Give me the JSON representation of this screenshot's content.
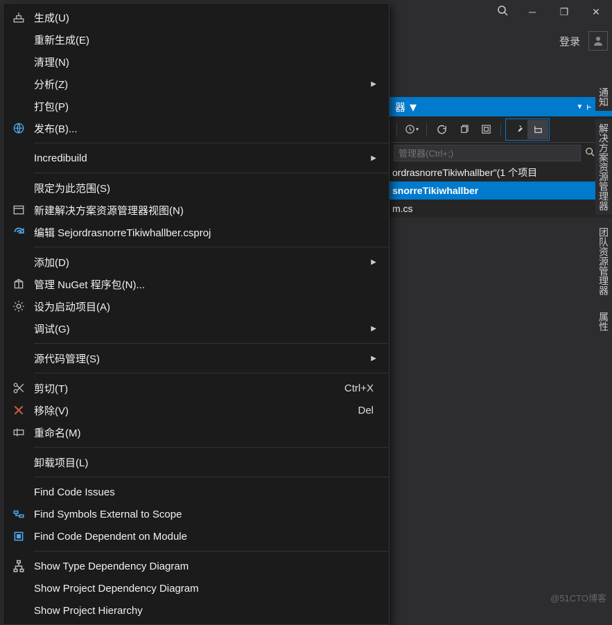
{
  "titlebar": {
    "min_label": "─",
    "restore_label": "❐",
    "close_label": "✕"
  },
  "signin": {
    "label": "登录"
  },
  "panel": {
    "title_frag": "器",
    "pin_dropdown": "▼",
    "search_placeholder": "管理器(Ctrl+;)"
  },
  "tree": {
    "solution_label": "ordrasnorreTikiwhallber\"(1 个项目",
    "project_label": "snorreTikiwhallber",
    "file_label": "m.cs"
  },
  "vtabs": {
    "t1": "通知",
    "t2": "解决方案资源管理器",
    "t3": "团队资源管理器",
    "t4": "属性"
  },
  "menu": {
    "build": "生成(U)",
    "rebuild": "重新生成(E)",
    "clean": "清理(N)",
    "analyze": "分析(Z)",
    "pack": "打包(P)",
    "publish": "发布(B)...",
    "incredibuild": "Incredibuild",
    "scope": "限定为此范围(S)",
    "new_view": "新建解决方案资源管理器视图(N)",
    "edit_csproj": "编辑 SejordrasnorreTikiwhallber.csproj",
    "add": "添加(D)",
    "nuget": "管理 NuGet 程序包(N)...",
    "set_startup": "设为启动项目(A)",
    "debug": "调试(G)",
    "source_control": "源代码管理(S)",
    "cut": "剪切(T)",
    "cut_key": "Ctrl+X",
    "remove": "移除(V)",
    "remove_key": "Del",
    "rename": "重命名(M)",
    "unload": "卸载项目(L)",
    "find_issues": "Find Code Issues",
    "find_symbols": "Find Symbols External to Scope",
    "find_dependent": "Find Code Dependent on Module",
    "show_type_diag": "Show Type Dependency Diagram",
    "show_proj_diag": "Show Project Dependency Diagram",
    "show_hierarchy": "Show Project Hierarchy"
  },
  "watermark": "@51CTO博客"
}
